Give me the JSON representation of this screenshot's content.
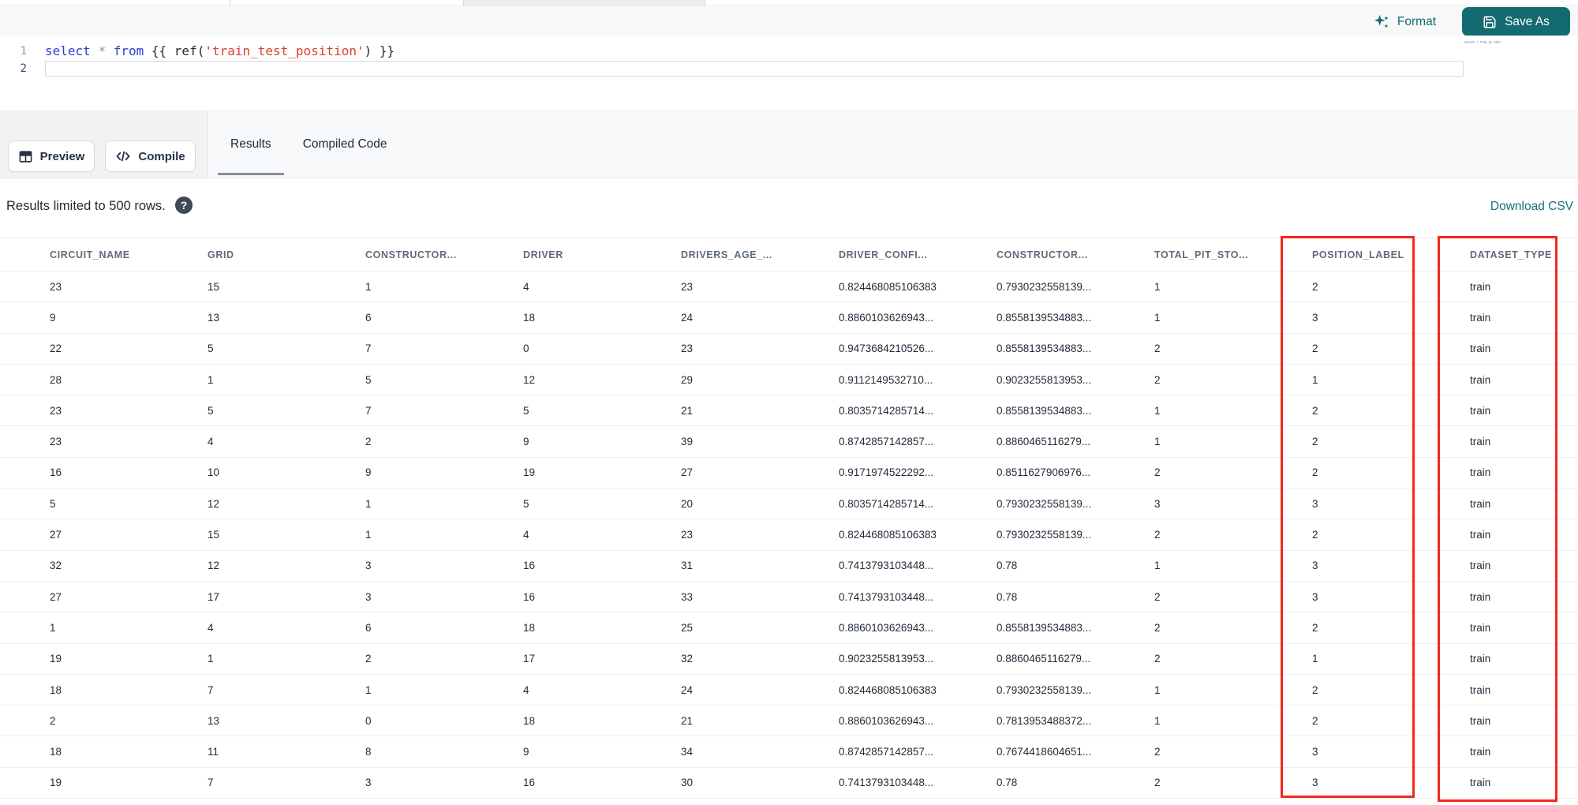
{
  "colors": {
    "accent_teal": "#136a70",
    "link_teal": "#17707e",
    "annotation_red": "#f5281c",
    "keyword_blue": "#2a3ed2",
    "string_red": "#dd3d2a",
    "header_text": "#5f6b7a",
    "cell_text": "#1f2a37"
  },
  "editor": {
    "format_label": "Format",
    "save_as_label": "Save As",
    "line_numbers": [
      "1",
      "2"
    ],
    "code_tokens": [
      {
        "text": "select",
        "type": "keyword"
      },
      {
        "text": " ",
        "type": "plain"
      },
      {
        "text": "*",
        "type": "operator"
      },
      {
        "text": " ",
        "type": "plain"
      },
      {
        "text": "from",
        "type": "keyword"
      },
      {
        "text": " ",
        "type": "plain"
      },
      {
        "text": "{{ ",
        "type": "bracket"
      },
      {
        "text": "ref(",
        "type": "function"
      },
      {
        "text": "'train_test_position'",
        "type": "string"
      },
      {
        "text": ") ",
        "type": "function"
      },
      {
        "text": "}}",
        "type": "bracket"
      }
    ]
  },
  "toolbar": {
    "preview_label": "Preview",
    "compile_label": "Compile"
  },
  "tabs": [
    {
      "label": "Results",
      "active": true
    },
    {
      "label": "Compiled Code",
      "active": false
    }
  ],
  "results_bar": {
    "limit_text": "Results limited to 500 rows.",
    "help_glyph": "?",
    "download_label": "Download CSV"
  },
  "table": {
    "headers": [
      "CIRCUIT_NAME",
      "GRID",
      "CONSTRUCTOR...",
      "DRIVER",
      "DRIVERS_AGE_...",
      "DRIVER_CONFI...",
      "CONSTRUCTOR...",
      "TOTAL_PIT_STO...",
      "POSITION_LABEL",
      "DATASET_TYPE"
    ],
    "rows": [
      [
        "23",
        "15",
        "1",
        "4",
        "23",
        "0.824468085106383",
        "0.7930232558139...",
        "1",
        "2",
        "train"
      ],
      [
        "9",
        "13",
        "6",
        "18",
        "24",
        "0.8860103626943...",
        "0.8558139534883...",
        "1",
        "3",
        "train"
      ],
      [
        "22",
        "5",
        "7",
        "0",
        "23",
        "0.9473684210526...",
        "0.8558139534883...",
        "2",
        "2",
        "train"
      ],
      [
        "28",
        "1",
        "5",
        "12",
        "29",
        "0.9112149532710...",
        "0.9023255813953...",
        "2",
        "1",
        "train"
      ],
      [
        "23",
        "5",
        "7",
        "5",
        "21",
        "0.8035714285714...",
        "0.8558139534883...",
        "1",
        "2",
        "train"
      ],
      [
        "23",
        "4",
        "2",
        "9",
        "39",
        "0.8742857142857...",
        "0.8860465116279...",
        "1",
        "2",
        "train"
      ],
      [
        "16",
        "10",
        "9",
        "19",
        "27",
        "0.9171974522292...",
        "0.8511627906976...",
        "2",
        "2",
        "train"
      ],
      [
        "5",
        "12",
        "1",
        "5",
        "20",
        "0.8035714285714...",
        "0.7930232558139...",
        "3",
        "3",
        "train"
      ],
      [
        "27",
        "15",
        "1",
        "4",
        "23",
        "0.824468085106383",
        "0.7930232558139...",
        "2",
        "2",
        "train"
      ],
      [
        "32",
        "12",
        "3",
        "16",
        "31",
        "0.7413793103448...",
        "0.78",
        "1",
        "3",
        "train"
      ],
      [
        "27",
        "17",
        "3",
        "16",
        "33",
        "0.7413793103448...",
        "0.78",
        "2",
        "3",
        "train"
      ],
      [
        "1",
        "4",
        "6",
        "18",
        "25",
        "0.8860103626943...",
        "0.8558139534883...",
        "2",
        "2",
        "train"
      ],
      [
        "19",
        "1",
        "2",
        "17",
        "32",
        "0.9023255813953...",
        "0.8860465116279...",
        "2",
        "1",
        "train"
      ],
      [
        "18",
        "7",
        "1",
        "4",
        "24",
        "0.824468085106383",
        "0.7930232558139...",
        "1",
        "2",
        "train"
      ],
      [
        "2",
        "13",
        "0",
        "18",
        "21",
        "0.8860103626943...",
        "0.7813953488372...",
        "1",
        "2",
        "train"
      ],
      [
        "18",
        "11",
        "8",
        "9",
        "34",
        "0.8742857142857...",
        "0.7674418604651...",
        "2",
        "3",
        "train"
      ],
      [
        "19",
        "7",
        "3",
        "16",
        "30",
        "0.7413793103448...",
        "0.78",
        "2",
        "3",
        "train"
      ]
    ],
    "highlighted_columns": [
      "POSITION_LABEL",
      "DATASET_TYPE"
    ]
  }
}
